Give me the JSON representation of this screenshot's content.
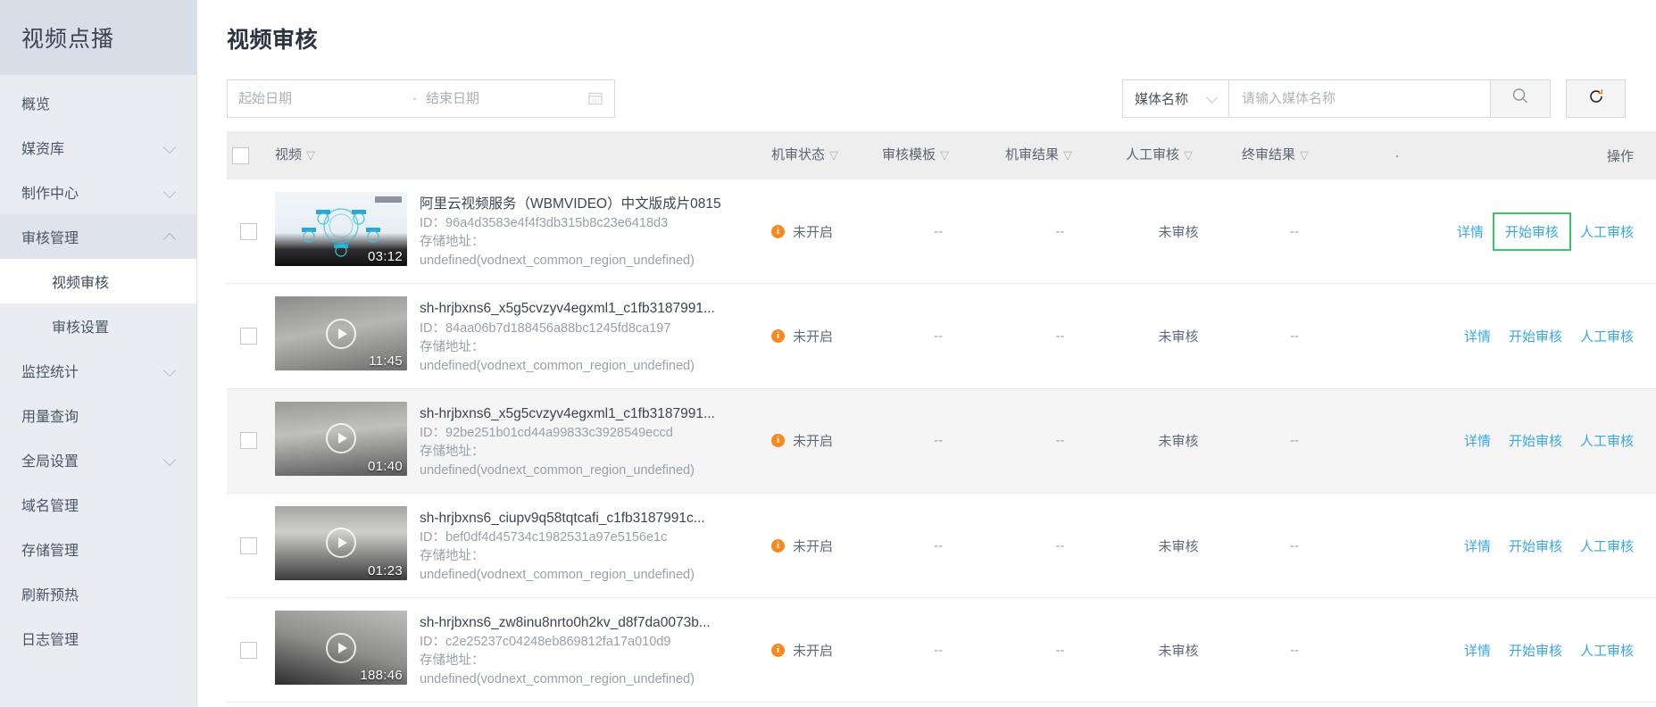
{
  "sidebar": {
    "brand": "视频点播",
    "items": [
      {
        "label": "概览",
        "expandable": false
      },
      {
        "label": "媒资库",
        "expandable": true
      },
      {
        "label": "制作中心",
        "expandable": true
      },
      {
        "label": "审核管理",
        "expandable": true,
        "expanded": true,
        "children": [
          {
            "label": "视频审核",
            "active": true
          },
          {
            "label": "审核设置",
            "active": false
          }
        ]
      },
      {
        "label": "监控统计",
        "expandable": true
      },
      {
        "label": "用量查询",
        "expandable": false
      },
      {
        "label": "全局设置",
        "expandable": true
      },
      {
        "label": "域名管理",
        "expandable": false
      },
      {
        "label": "存储管理",
        "expandable": false
      },
      {
        "label": "刷新预热",
        "expandable": false
      },
      {
        "label": "日志管理",
        "expandable": false
      }
    ]
  },
  "page": {
    "title": "视频审核"
  },
  "filters": {
    "start_date_placeholder": "起始日期",
    "end_date_placeholder": "结束日期",
    "start_date_value": "",
    "end_date_value": "",
    "range_separator": "-",
    "calendar_icon": "calendar-icon",
    "search_field_label": "媒体名称",
    "search_placeholder": "请输入媒体名称",
    "search_value": "",
    "search_icon": "search-icon",
    "refresh_icon": "refresh-icon"
  },
  "table": {
    "columns": [
      {
        "key": "checkbox",
        "label": ""
      },
      {
        "key": "video",
        "label": "视频",
        "filterable": true
      },
      {
        "key": "machine_status",
        "label": "机审状态",
        "filterable": true
      },
      {
        "key": "audit_template",
        "label": "审核模板",
        "filterable": true
      },
      {
        "key": "machine_result",
        "label": "机审结果",
        "filterable": true
      },
      {
        "key": "manual_audit",
        "label": "人工审核",
        "filterable": true
      },
      {
        "key": "final_result",
        "label": "终审结果",
        "filterable": true
      },
      {
        "key": "blank",
        "label": "·"
      },
      {
        "key": "ops",
        "label": "操作"
      }
    ],
    "id_prefix": "ID：",
    "storage_prefix": "存储地址：",
    "rows": [
      {
        "checked": false,
        "hovered": false,
        "title": "阿里云视频服务（WBMVIDEO）中文版成片0815",
        "id": "96a4d3583e4f4f3db315b8c23e6418d3",
        "storage": "undefined(vodnext_common_region_undefined)",
        "duration": "03:12",
        "thumb_style": "t-alicloud",
        "machine_status": "未开启",
        "audit_template": "--",
        "machine_result": "--",
        "manual_audit": "未审核",
        "final_result": "--",
        "ops": [
          {
            "label": "详情",
            "highlighted": false
          },
          {
            "label": "开始审核",
            "highlighted": true
          },
          {
            "label": "人工审核",
            "highlighted": false
          }
        ]
      },
      {
        "checked": false,
        "hovered": false,
        "title": "sh-hrjbxns6_x5g5cvzyv4egxml1_c1fb3187991...",
        "id": "84aa06b7d188456a88bc1245fd8ca197",
        "storage": "undefined(vodnext_common_region_undefined)",
        "duration": "11:45",
        "thumb_style": "t-gray",
        "machine_status": "未开启",
        "audit_template": "--",
        "machine_result": "--",
        "manual_audit": "未审核",
        "final_result": "--",
        "ops": [
          {
            "label": "详情",
            "highlighted": false
          },
          {
            "label": "开始审核",
            "highlighted": false
          },
          {
            "label": "人工审核",
            "highlighted": false
          }
        ]
      },
      {
        "checked": false,
        "hovered": true,
        "title": "sh-hrjbxns6_x5g5cvzyv4egxml1_c1fb3187991...",
        "id": "92be251b01cd44a99833c3928549eccd",
        "storage": "undefined(vodnext_common_region_undefined)",
        "duration": "01:40",
        "thumb_style": "t-gray2",
        "machine_status": "未开启",
        "audit_template": "--",
        "machine_result": "--",
        "manual_audit": "未审核",
        "final_result": "--",
        "ops": [
          {
            "label": "详情",
            "highlighted": false
          },
          {
            "label": "开始审核",
            "highlighted": false
          },
          {
            "label": "人工审核",
            "highlighted": false
          }
        ]
      },
      {
        "checked": false,
        "hovered": false,
        "title": "sh-hrjbxns6_ciupv9q58tqtcafi_c1fb3187991c...",
        "id": "bef0df4d45734c1982531a97e5156e1c",
        "storage": "undefined(vodnext_common_region_undefined)",
        "duration": "01:23",
        "thumb_style": "t-gray3",
        "machine_status": "未开启",
        "audit_template": "--",
        "machine_result": "--",
        "manual_audit": "未审核",
        "final_result": "--",
        "ops": [
          {
            "label": "详情",
            "highlighted": false
          },
          {
            "label": "开始审核",
            "highlighted": false
          },
          {
            "label": "人工审核",
            "highlighted": false
          }
        ]
      },
      {
        "checked": false,
        "hovered": false,
        "title": "sh-hrjbxns6_zw8inu8nrto0h2kv_d8f7da0073b...",
        "id": "c2e25237c04248eb869812fa17a010d9",
        "storage": "undefined(vodnext_common_region_undefined)",
        "duration": "188:46",
        "thumb_style": "t-gray4",
        "machine_status": "未开启",
        "audit_template": "--",
        "machine_result": "--",
        "manual_audit": "未审核",
        "final_result": "--",
        "ops": [
          {
            "label": "详情",
            "highlighted": false
          },
          {
            "label": "开始审核",
            "highlighted": false
          },
          {
            "label": "人工审核",
            "highlighted": false
          }
        ]
      }
    ]
  },
  "colors": {
    "link": "#3aa8e0",
    "highlight_border": "#3ac569",
    "warning": "#f68a1e",
    "sidebar_bg": "#e9edf2",
    "sidebar_brand_bg": "#d8dee7",
    "table_header_bg": "#eeeeee"
  }
}
